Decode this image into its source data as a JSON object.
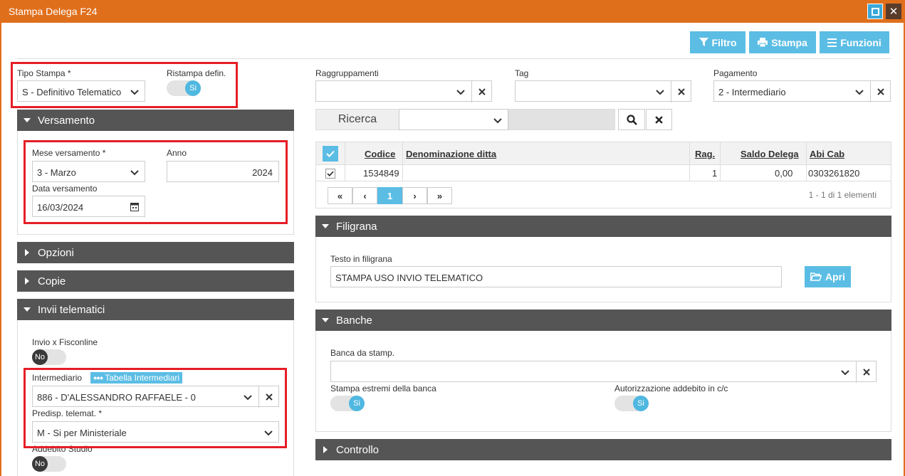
{
  "window": {
    "title": "Stampa Delega F24"
  },
  "toolbar": {
    "filter_label": "Filtro",
    "print_label": "Stampa",
    "functions_label": "Funzioni"
  },
  "tipo_stampa": {
    "label": "Tipo Stampa *",
    "value": "S - Definitivo Telematico"
  },
  "ristampa": {
    "label": "Ristampa defin.",
    "value": "Si"
  },
  "raggruppamenti": {
    "label": "Raggruppamenti",
    "value": ""
  },
  "tag": {
    "label": "Tag",
    "value": ""
  },
  "pagamento": {
    "label": "Pagamento",
    "value": "2 - Intermediario"
  },
  "ricerca": {
    "label": "Ricerca",
    "value": ""
  },
  "versamento": {
    "title": "Versamento",
    "mese_label": "Mese versamento *",
    "mese_value": "3 - Marzo",
    "anno_label": "Anno",
    "anno_value": "2024",
    "data_label": "Data versamento",
    "data_value": "16/03/2024"
  },
  "opzioni": {
    "title": "Opzioni"
  },
  "copie": {
    "title": "Copie"
  },
  "invii": {
    "title": "Invii telematici",
    "fisconline_label": "Invio x Fisconline",
    "fisconline_value": "No",
    "intermediario_label": "Intermediario",
    "tabella_label": "Tabella Intermediari",
    "intermediario_value": "886 - D'ALESSANDRO RAFFAELE - 0",
    "predisp_label": "Predisp. telemat. *",
    "predisp_value": "M - Si per Ministeriale",
    "addebito_label": "Addebito Studio",
    "addebito_value": "No"
  },
  "grid": {
    "columns": [
      "Codice",
      "Denominazione ditta",
      "Rag.",
      "Saldo Delega",
      "Abi Cab"
    ],
    "rows": [
      {
        "codice": "1534849",
        "denominazione": "",
        "rag": "1",
        "saldo": "0,00",
        "abicab": "0303261820"
      }
    ],
    "pager": {
      "first": "«",
      "prev": "‹",
      "page": "1",
      "next": "›",
      "last": "»"
    },
    "info": "1 - 1 di 1 elementi"
  },
  "filigrana": {
    "title": "Filigrana",
    "label": "Testo in filigrana",
    "value": "STAMPA USO INVIO TELEMATICO",
    "open_label": "Apri"
  },
  "banche": {
    "title": "Banche",
    "banca_label": "Banca da stamp.",
    "banca_value": "",
    "estremi_label": "Stampa estremi della banca",
    "estremi_value": "Si",
    "autorizz_label": "Autorizzazione addebito in c/c",
    "autorizz_value": "Si"
  },
  "controllo": {
    "title": "Controllo"
  },
  "icons": [
    "maximize-icon",
    "close-icon",
    "filter-icon",
    "printer-icon",
    "menu-icon",
    "chevron-down-icon",
    "clear-icon",
    "search-icon",
    "calendar-icon",
    "checkbox-icon",
    "caret-down-icon",
    "caret-right-icon",
    "folder-open-icon",
    "dots-icon"
  ],
  "colors": {
    "titlebar": "#e06f1c",
    "accent": "#5bbde4",
    "panel_header": "#555555",
    "highlight_box": "#e51e26"
  }
}
